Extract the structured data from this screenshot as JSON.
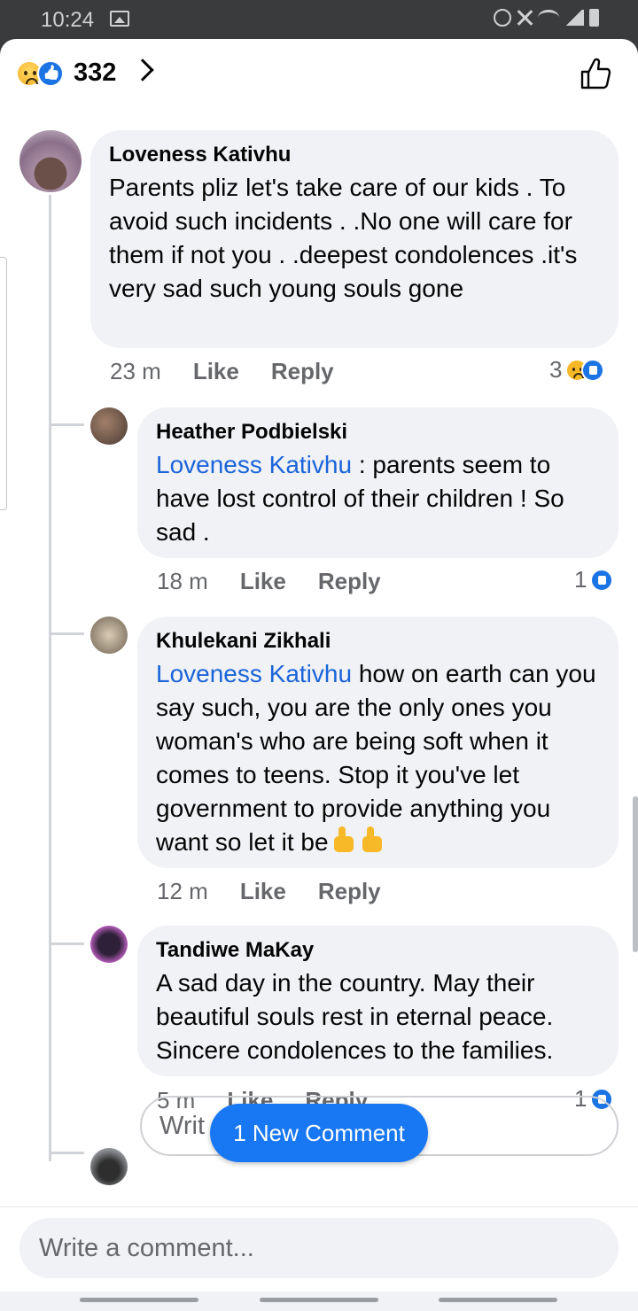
{
  "status_bar": {
    "time": "10:24"
  },
  "header": {
    "reaction_count": "332"
  },
  "comments": [
    {
      "author": "Loveness Kativhu",
      "text": "Parents pliz let's take care of our kids . To avoid such incidents . .No one will care for them if not you . .deepest condolences .it's very sad such young souls gone",
      "time": "23 m",
      "like_label": "Like",
      "reply_label": "Reply",
      "reactions": "3"
    },
    {
      "author": "Heather Podbielski",
      "mention": "Loveness Kativhu",
      "text": " : parents seem to have lost control of their children ! So sad .",
      "time": "18 m",
      "like_label": "Like",
      "reply_label": "Reply",
      "reactions": "1"
    },
    {
      "author": "Khulekani Zikhali",
      "mention": "Loveness Kativhu",
      "text": " how on earth can you say such, you are the only ones you woman's who are being soft when it comes to teens. Stop it you've let government to provide anything you want so let it be",
      "time": "12 m",
      "like_label": "Like",
      "reply_label": "Reply"
    },
    {
      "author": "Tandiwe MaKay",
      "text": "A sad day in the country. May their beautiful souls rest in eternal peace. Sincere condolences to the families.",
      "time": "5 m",
      "like_label": "Like",
      "reply_label": "Reply",
      "reactions": "1"
    }
  ],
  "reply_box": {
    "placeholder": "Writ"
  },
  "new_comment_pill": "1 New Comment",
  "composer": {
    "placeholder": "Write a comment..."
  },
  "colors": {
    "accent": "#1877f2",
    "bubble": "#f0f2f5",
    "mention": "#1b64d9"
  }
}
